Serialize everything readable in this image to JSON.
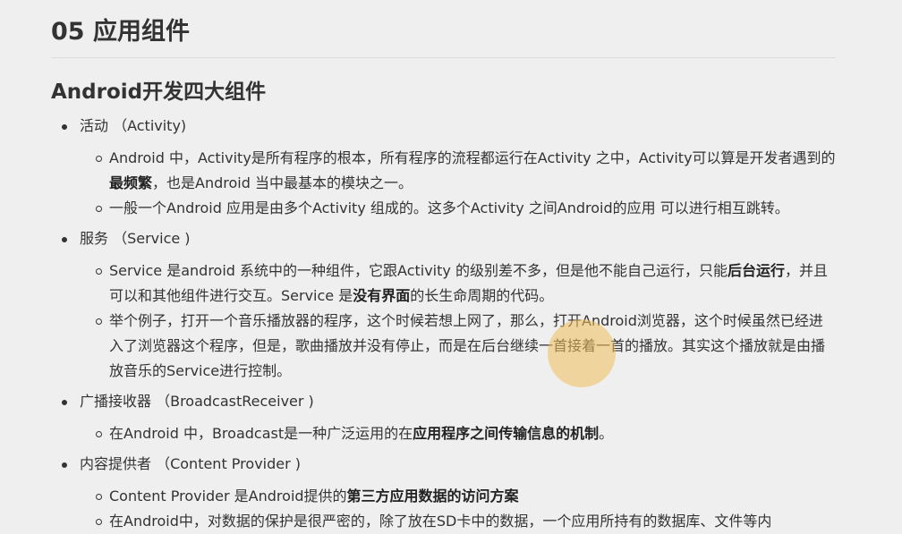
{
  "title": "05 应用组件",
  "subtitle": "Android开发四大组件",
  "items": [
    {
      "label": "活动 （Activity)",
      "subs": [
        {
          "p1": "Android 中，Activity是所有程序的根本，所有程序的流程都运行在Activity 之中，Activity可以算是开发者遇到的",
          "b1": "最频繁",
          "p2": "，也是Android 当中最基本的模块之一。"
        },
        {
          "p1": "一般一个Android 应用是由多个Activity 组成的。这多个Activity 之间Android的应用 可以进行相互跳转。"
        }
      ]
    },
    {
      "label": "服务 （Service )",
      "subs": [
        {
          "p1": "Service 是android 系统中的一种组件，它跟Activity 的级别差不多，但是他不能自己运行，只能",
          "b1": "后台运行",
          "p2": "，并且可以和其他组件进行交互。Service 是",
          "b2": "没有界面",
          "p3": "的长生命周期的代码。"
        },
        {
          "p1": "举个例子，打开一个音乐播放器的程序，这个时候若想上网了，那么，打开Android浏览器，这个时候虽然已经进入了浏览器这个程序，但是，歌曲播放并没有停止，而是在后台继续一首接着一首的播放。其实这个播放就是由播放音乐的Service进行控制。"
        }
      ]
    },
    {
      "label": "广播接收器 （BroadcastReceiver )",
      "subs": [
        {
          "p1": "在Android 中，Broadcast是一种广泛运用的在",
          "b1": "应用程序之间传输信息的机制",
          "p2": "。"
        }
      ]
    },
    {
      "label": "内容提供者 （Content Provider )",
      "subs": [
        {
          "p1": "Content Provider 是Android提供的",
          "b1": "第三方应用数据的访问方案"
        },
        {
          "p1": "在Android中，对数据的保护是很严密的，除了放在SD卡中的数据，一个应用所持有的数据库、文件等内"
        }
      ]
    }
  ],
  "cursor_highlight_color": "#f0be5a"
}
